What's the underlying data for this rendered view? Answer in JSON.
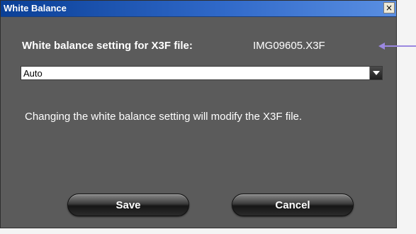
{
  "window": {
    "title": "White Balance",
    "close_glyph": "×"
  },
  "dialog": {
    "setting_label": "White balance setting for X3F file:",
    "filename": "IMG09605.X3F",
    "select_value": "Auto",
    "message": "Changing the white balance setting will modify the X3F file."
  },
  "buttons": {
    "save_label": "Save",
    "cancel_label": "Cancel"
  },
  "icons": {
    "close": "close-icon",
    "dropdown": "chevron-down-icon",
    "pointer": "arrow-left-icon"
  },
  "colors": {
    "titlebar": "#2f68c8",
    "dialog_bg": "#5b5b5b",
    "arrow": "#9b88e0"
  }
}
